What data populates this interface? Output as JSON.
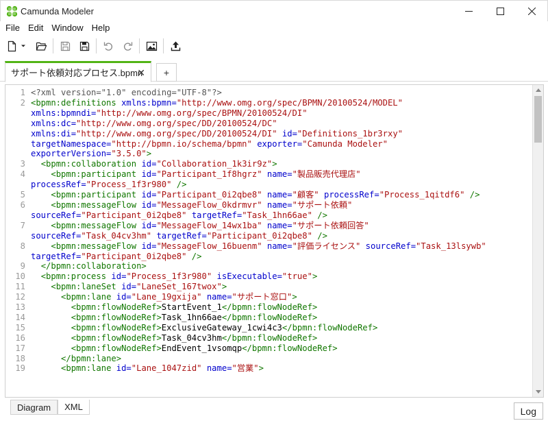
{
  "window": {
    "title": "Camunda Modeler"
  },
  "menu": [
    "File",
    "Edit",
    "Window",
    "Help"
  ],
  "toolbar": {
    "icons": [
      "new-file-icon",
      "dropdown-arrow-icon",
      "open-folder-icon",
      "save-icon",
      "save-all-icon",
      "undo-icon",
      "redo-icon",
      "export-image-icon",
      "deploy-icon"
    ]
  },
  "tabs": {
    "active_label": "サポート依頼対応プロセス.bpmn",
    "close_glyph": "✕",
    "add_glyph": "+"
  },
  "editor": {
    "lines": [
      {
        "n": "1",
        "tokens": [
          {
            "c": "meta",
            "t": "<?xml version=\"1.0\" encoding=\"UTF-8\"?>"
          }
        ]
      },
      {
        "n": "2",
        "tokens": [
          {
            "c": "tag",
            "t": "<bpmn:definitions "
          },
          {
            "c": "attr",
            "t": "xmlns:bpmn="
          },
          {
            "c": "str",
            "t": "\"http://www.omg.org/spec/BPMN/20100524/MODEL\""
          }
        ]
      },
      {
        "n": "",
        "tokens": [
          {
            "c": "attr",
            "t": "xmlns:bpmndi="
          },
          {
            "c": "str",
            "t": "\"http://www.omg.org/spec/BPMN/20100524/DI\""
          }
        ]
      },
      {
        "n": "",
        "tokens": [
          {
            "c": "attr",
            "t": "xmlns:dc="
          },
          {
            "c": "str",
            "t": "\"http://www.omg.org/spec/DD/20100524/DC\""
          }
        ]
      },
      {
        "n": "",
        "tokens": [
          {
            "c": "attr",
            "t": "xmlns:di="
          },
          {
            "c": "str",
            "t": "\"http://www.omg.org/spec/DD/20100524/DI\""
          },
          {
            "c": "text",
            "t": " "
          },
          {
            "c": "attr",
            "t": "id="
          },
          {
            "c": "str",
            "t": "\"Definitions_1br3rxy\""
          }
        ]
      },
      {
        "n": "",
        "tokens": [
          {
            "c": "attr",
            "t": "targetNamespace="
          },
          {
            "c": "str",
            "t": "\"http://bpmn.io/schema/bpmn\""
          },
          {
            "c": "text",
            "t": " "
          },
          {
            "c": "attr",
            "t": "exporter="
          },
          {
            "c": "str",
            "t": "\"Camunda Modeler\""
          }
        ]
      },
      {
        "n": "",
        "tokens": [
          {
            "c": "attr",
            "t": "exporterVersion="
          },
          {
            "c": "str",
            "t": "\"3.5.0\""
          },
          {
            "c": "tag",
            "t": ">"
          }
        ]
      },
      {
        "n": "3",
        "tokens": [
          {
            "c": "text",
            "t": "  "
          },
          {
            "c": "tag",
            "t": "<bpmn:collaboration "
          },
          {
            "c": "attr",
            "t": "id="
          },
          {
            "c": "str",
            "t": "\"Collaboration_1k3ir9z\""
          },
          {
            "c": "tag",
            "t": ">"
          }
        ]
      },
      {
        "n": "4",
        "tokens": [
          {
            "c": "text",
            "t": "    "
          },
          {
            "c": "tag",
            "t": "<bpmn:participant "
          },
          {
            "c": "attr",
            "t": "id="
          },
          {
            "c": "str",
            "t": "\"Participant_1f8hgrz\""
          },
          {
            "c": "text",
            "t": " "
          },
          {
            "c": "attr",
            "t": "name="
          },
          {
            "c": "str",
            "t": "\"製品販売代理店\""
          }
        ]
      },
      {
        "n": "",
        "tokens": [
          {
            "c": "attr",
            "t": "processRef="
          },
          {
            "c": "str",
            "t": "\"Process_1f3r980\""
          },
          {
            "c": "tag",
            "t": " />"
          }
        ]
      },
      {
        "n": "5",
        "tokens": [
          {
            "c": "text",
            "t": "    "
          },
          {
            "c": "tag",
            "t": "<bpmn:participant "
          },
          {
            "c": "attr",
            "t": "id="
          },
          {
            "c": "str",
            "t": "\"Participant_0i2qbe8\""
          },
          {
            "c": "text",
            "t": " "
          },
          {
            "c": "attr",
            "t": "name="
          },
          {
            "c": "str",
            "t": "\"顧客\""
          },
          {
            "c": "text",
            "t": " "
          },
          {
            "c": "attr",
            "t": "processRef="
          },
          {
            "c": "str",
            "t": "\"Process_1qitdf6\""
          },
          {
            "c": "tag",
            "t": " />"
          }
        ]
      },
      {
        "n": "6",
        "tokens": [
          {
            "c": "text",
            "t": "    "
          },
          {
            "c": "tag",
            "t": "<bpmn:messageFlow "
          },
          {
            "c": "attr",
            "t": "id="
          },
          {
            "c": "str",
            "t": "\"MessageFlow_0kdrmvr\""
          },
          {
            "c": "text",
            "t": " "
          },
          {
            "c": "attr",
            "t": "name="
          },
          {
            "c": "str",
            "t": "\"サポート依頼\""
          }
        ]
      },
      {
        "n": "",
        "tokens": [
          {
            "c": "attr",
            "t": "sourceRef="
          },
          {
            "c": "str",
            "t": "\"Participant_0i2qbe8\""
          },
          {
            "c": "text",
            "t": " "
          },
          {
            "c": "attr",
            "t": "targetRef="
          },
          {
            "c": "str",
            "t": "\"Task_1hn66ae\""
          },
          {
            "c": "tag",
            "t": " />"
          }
        ]
      },
      {
        "n": "7",
        "tokens": [
          {
            "c": "text",
            "t": "    "
          },
          {
            "c": "tag",
            "t": "<bpmn:messageFlow "
          },
          {
            "c": "attr",
            "t": "id="
          },
          {
            "c": "str",
            "t": "\"MessageFlow_14wx1ba\""
          },
          {
            "c": "text",
            "t": " "
          },
          {
            "c": "attr",
            "t": "name="
          },
          {
            "c": "str",
            "t": "\"サポート依頼回答\""
          }
        ]
      },
      {
        "n": "",
        "tokens": [
          {
            "c": "attr",
            "t": "sourceRef="
          },
          {
            "c": "str",
            "t": "\"Task_04cv3hm\""
          },
          {
            "c": "text",
            "t": " "
          },
          {
            "c": "attr",
            "t": "targetRef="
          },
          {
            "c": "str",
            "t": "\"Participant_0i2qbe8\""
          },
          {
            "c": "tag",
            "t": " />"
          }
        ]
      },
      {
        "n": "8",
        "tokens": [
          {
            "c": "text",
            "t": "    "
          },
          {
            "c": "tag",
            "t": "<bpmn:messageFlow "
          },
          {
            "c": "attr",
            "t": "id="
          },
          {
            "c": "str",
            "t": "\"MessageFlow_16buenm\""
          },
          {
            "c": "text",
            "t": " "
          },
          {
            "c": "attr",
            "t": "name="
          },
          {
            "c": "str",
            "t": "\"評価ライセンス\""
          },
          {
            "c": "text",
            "t": " "
          },
          {
            "c": "attr",
            "t": "sourceRef="
          },
          {
            "c": "str",
            "t": "\"Task_13lsywb\""
          }
        ]
      },
      {
        "n": "",
        "tokens": [
          {
            "c": "attr",
            "t": "targetRef="
          },
          {
            "c": "str",
            "t": "\"Participant_0i2qbe8\""
          },
          {
            "c": "tag",
            "t": " />"
          }
        ]
      },
      {
        "n": "9",
        "tokens": [
          {
            "c": "text",
            "t": "  "
          },
          {
            "c": "tag",
            "t": "</bpmn:collaboration>"
          }
        ]
      },
      {
        "n": "10",
        "tokens": [
          {
            "c": "text",
            "t": "  "
          },
          {
            "c": "tag",
            "t": "<bpmn:process "
          },
          {
            "c": "attr",
            "t": "id="
          },
          {
            "c": "str",
            "t": "\"Process_1f3r980\""
          },
          {
            "c": "text",
            "t": " "
          },
          {
            "c": "attr",
            "t": "isExecutable="
          },
          {
            "c": "str",
            "t": "\"true\""
          },
          {
            "c": "tag",
            "t": ">"
          }
        ]
      },
      {
        "n": "11",
        "tokens": [
          {
            "c": "text",
            "t": "    "
          },
          {
            "c": "tag",
            "t": "<bpmn:laneSet "
          },
          {
            "c": "attr",
            "t": "id="
          },
          {
            "c": "str",
            "t": "\"LaneSet_167twox\""
          },
          {
            "c": "tag",
            "t": ">"
          }
        ]
      },
      {
        "n": "12",
        "tokens": [
          {
            "c": "text",
            "t": "      "
          },
          {
            "c": "tag",
            "t": "<bpmn:lane "
          },
          {
            "c": "attr",
            "t": "id="
          },
          {
            "c": "str",
            "t": "\"Lane_19gxija\""
          },
          {
            "c": "text",
            "t": " "
          },
          {
            "c": "attr",
            "t": "name="
          },
          {
            "c": "str",
            "t": "\"サポート窓口\""
          },
          {
            "c": "tag",
            "t": ">"
          }
        ]
      },
      {
        "n": "13",
        "tokens": [
          {
            "c": "text",
            "t": "        "
          },
          {
            "c": "tag",
            "t": "<bpmn:flowNodeRef>"
          },
          {
            "c": "text",
            "t": "StartEvent_1"
          },
          {
            "c": "tag",
            "t": "</bpmn:flowNodeRef>"
          }
        ]
      },
      {
        "n": "14",
        "tokens": [
          {
            "c": "text",
            "t": "        "
          },
          {
            "c": "tag",
            "t": "<bpmn:flowNodeRef>"
          },
          {
            "c": "text",
            "t": "Task_1hn66ae"
          },
          {
            "c": "tag",
            "t": "</bpmn:flowNodeRef>"
          }
        ]
      },
      {
        "n": "15",
        "tokens": [
          {
            "c": "text",
            "t": "        "
          },
          {
            "c": "tag",
            "t": "<bpmn:flowNodeRef>"
          },
          {
            "c": "text",
            "t": "ExclusiveGateway_1cwi4c3"
          },
          {
            "c": "tag",
            "t": "</bpmn:flowNodeRef>"
          }
        ]
      },
      {
        "n": "16",
        "tokens": [
          {
            "c": "text",
            "t": "        "
          },
          {
            "c": "tag",
            "t": "<bpmn:flowNodeRef>"
          },
          {
            "c": "text",
            "t": "Task_04cv3hm"
          },
          {
            "c": "tag",
            "t": "</bpmn:flowNodeRef>"
          }
        ]
      },
      {
        "n": "17",
        "tokens": [
          {
            "c": "text",
            "t": "        "
          },
          {
            "c": "tag",
            "t": "<bpmn:flowNodeRef>"
          },
          {
            "c": "text",
            "t": "EndEvent_1vsomqp"
          },
          {
            "c": "tag",
            "t": "</bpmn:flowNodeRef>"
          }
        ]
      },
      {
        "n": "18",
        "tokens": [
          {
            "c": "text",
            "t": "      "
          },
          {
            "c": "tag",
            "t": "</bpmn:lane>"
          }
        ]
      },
      {
        "n": "19",
        "tokens": [
          {
            "c": "text",
            "t": "      "
          },
          {
            "c": "tag",
            "t": "<bpmn:lane "
          },
          {
            "c": "attr",
            "t": "id="
          },
          {
            "c": "str",
            "t": "\"Lane_1047zid\""
          },
          {
            "c": "text",
            "t": " "
          },
          {
            "c": "attr",
            "t": "name="
          },
          {
            "c": "str",
            "t": "\"営業\""
          },
          {
            "c": "tag",
            "t": ">"
          }
        ]
      }
    ]
  },
  "bottom_tabs": {
    "diagram": "Diagram",
    "xml": "XML"
  },
  "log_button": "Log",
  "colors": {
    "accent": "#52b415",
    "tag": "#117700",
    "attribute": "#0000cc",
    "string": "#aa1111"
  }
}
